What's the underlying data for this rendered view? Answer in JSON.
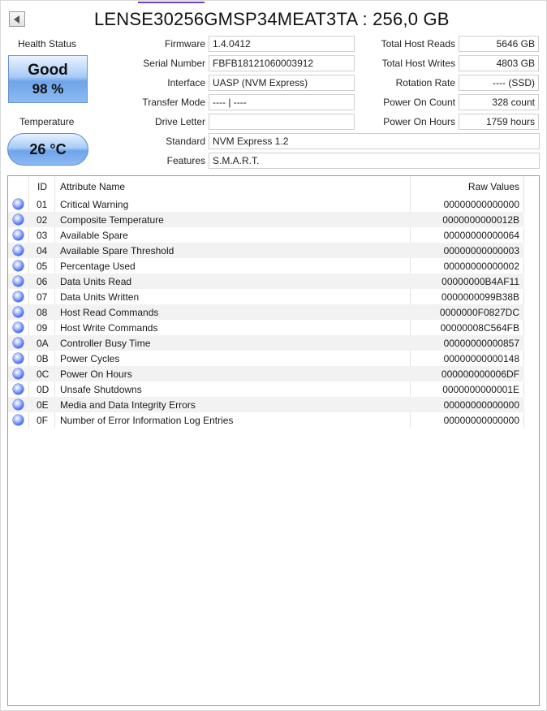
{
  "title": "LENSE30256GMSP34MEAT3TA : 256,0 GB",
  "health": {
    "label": "Health Status",
    "status": "Good",
    "percent": "98 %",
    "color": "#8dbaf3"
  },
  "temperature": {
    "label": "Temperature",
    "value": "26 °C"
  },
  "info_left": [
    {
      "label": "Firmware",
      "value": "1.4.0412"
    },
    {
      "label": "Serial Number",
      "value": "FBFB18121060003912"
    },
    {
      "label": "Interface",
      "value": "UASP (NVM Express)"
    },
    {
      "label": "Transfer Mode",
      "value": "---- | ----"
    },
    {
      "label": "Drive Letter",
      "value": ""
    },
    {
      "label": "Standard",
      "value": "NVM Express 1.2"
    },
    {
      "label": "Features",
      "value": "S.M.A.R.T."
    }
  ],
  "info_right": [
    {
      "label": "Total Host Reads",
      "value": "5646 GB"
    },
    {
      "label": "Total Host Writes",
      "value": "4803 GB"
    },
    {
      "label": "Rotation Rate",
      "value": "---- (SSD)"
    },
    {
      "label": "Power On Count",
      "value": "328 count"
    },
    {
      "label": "Power On Hours",
      "value": "1759 hours"
    }
  ],
  "table": {
    "headers": {
      "id": "ID",
      "name": "Attribute Name",
      "raw": "Raw Values"
    },
    "rows": [
      {
        "id": "01",
        "name": "Critical Warning",
        "raw": "00000000000000"
      },
      {
        "id": "02",
        "name": "Composite Temperature",
        "raw": "0000000000012B"
      },
      {
        "id": "03",
        "name": "Available Spare",
        "raw": "00000000000064"
      },
      {
        "id": "04",
        "name": "Available Spare Threshold",
        "raw": "00000000000003"
      },
      {
        "id": "05",
        "name": "Percentage Used",
        "raw": "00000000000002"
      },
      {
        "id": "06",
        "name": "Data Units Read",
        "raw": "00000000B4AF11"
      },
      {
        "id": "07",
        "name": "Data Units Written",
        "raw": "0000000099B38B"
      },
      {
        "id": "08",
        "name": "Host Read Commands",
        "raw": "0000000F0827DC"
      },
      {
        "id": "09",
        "name": "Host Write Commands",
        "raw": "00000008C564FB"
      },
      {
        "id": "0A",
        "name": "Controller Busy Time",
        "raw": "00000000000857"
      },
      {
        "id": "0B",
        "name": "Power Cycles",
        "raw": "00000000000148"
      },
      {
        "id": "0C",
        "name": "Power On Hours",
        "raw": "000000000006DF"
      },
      {
        "id": "0D",
        "name": "Unsafe Shutdowns",
        "raw": "0000000000001E"
      },
      {
        "id": "0E",
        "name": "Media and Data Integrity Errors",
        "raw": "00000000000000"
      },
      {
        "id": "0F",
        "name": "Number of Error Information Log Entries",
        "raw": "00000000000000"
      }
    ]
  }
}
